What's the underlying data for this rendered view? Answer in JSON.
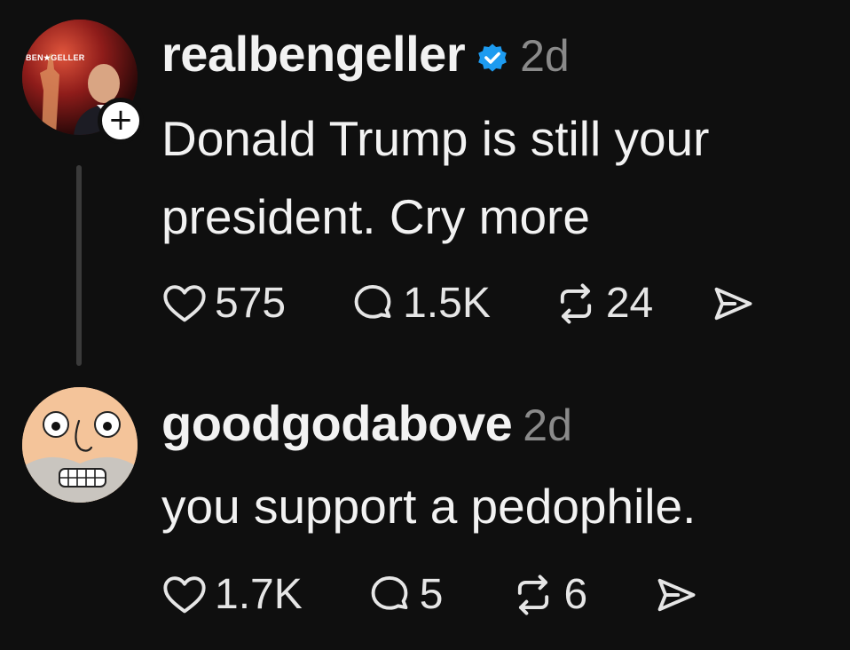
{
  "posts": [
    {
      "username": "realbengeller",
      "verified": true,
      "timestamp": "2d",
      "avatar_logo_text": "BEN★GELLER",
      "text": "Donald Trump is still your president. Cry more",
      "likes": "575",
      "replies": "1.5K",
      "reposts": "24"
    },
    {
      "username": "goodgodabove",
      "verified": false,
      "timestamp": "2d",
      "text": "you support a pedophile.",
      "likes": "1.7K",
      "replies": "5",
      "reposts": "6"
    }
  ],
  "colors": {
    "background": "#0f0f0f",
    "text": "#f2f2f2",
    "muted": "#8a8a8a",
    "verified_blue": "#1d9bf0",
    "thread_line": "#3a3a3a"
  },
  "icons": {
    "like": "heart-icon",
    "reply": "speech-bubble-icon",
    "repost": "repost-arrows-icon",
    "share": "send-icon",
    "follow": "plus-icon",
    "verified": "verified-badge-icon"
  }
}
